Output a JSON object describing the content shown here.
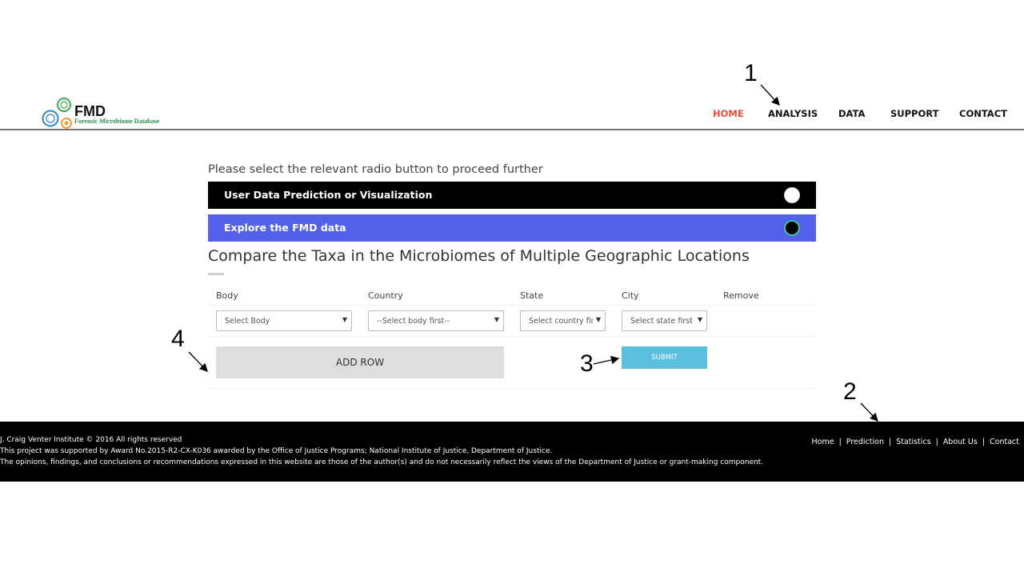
{
  "header": {
    "logo_title": "FMD",
    "logo_subtitle": "Forensic Microbiome Database",
    "nav": [
      "HOME",
      "ANALYSIS",
      "DATA",
      "SUPPORT",
      "CONTACT"
    ],
    "active_nav": "HOME"
  },
  "annotations": [
    "1",
    "2",
    "3",
    "4"
  ],
  "content": {
    "intro": "Please select the relevant radio button to proceed further",
    "options": [
      {
        "label": "User Data Prediction or Visualization",
        "selected": false
      },
      {
        "label": "Explore the FMD data",
        "selected": true
      }
    ],
    "section_title": "Compare the Taxa in the Microbiomes of Multiple Geographic Locations",
    "table_headers": [
      "Body",
      "Country",
      "State",
      "City",
      "Remove"
    ],
    "selects": {
      "body": "Select Body",
      "country": "--Select body first--",
      "state": "Select country first",
      "city": "Select state first"
    },
    "add_row_label": "ADD ROW",
    "submit_label": "SUBMIT"
  },
  "footer": {
    "line1": "J. Craig Venter Institute © 2016 All rights reserved",
    "line2": "This project was supported by Award No.2015-R2-CX-K036 awarded by the Office of Justice Programs; National Institute of Justice, Department of Justice.",
    "line3": "The opinions, findings, and conclusions or recommendations expressed in this website are those of the author(s) and do not necessarily reflect the views of the Department of Justice or grant-making component.",
    "links": [
      "Home",
      "Prediction",
      "Statistics",
      "About Us",
      "Contact"
    ]
  },
  "colors": {
    "nav_active": "#e74c3c",
    "bar_dark": "#000000",
    "bar_accent": "#5261e8",
    "submit": "#5bc0de",
    "add_row": "#dedede",
    "footer": "#000000"
  }
}
